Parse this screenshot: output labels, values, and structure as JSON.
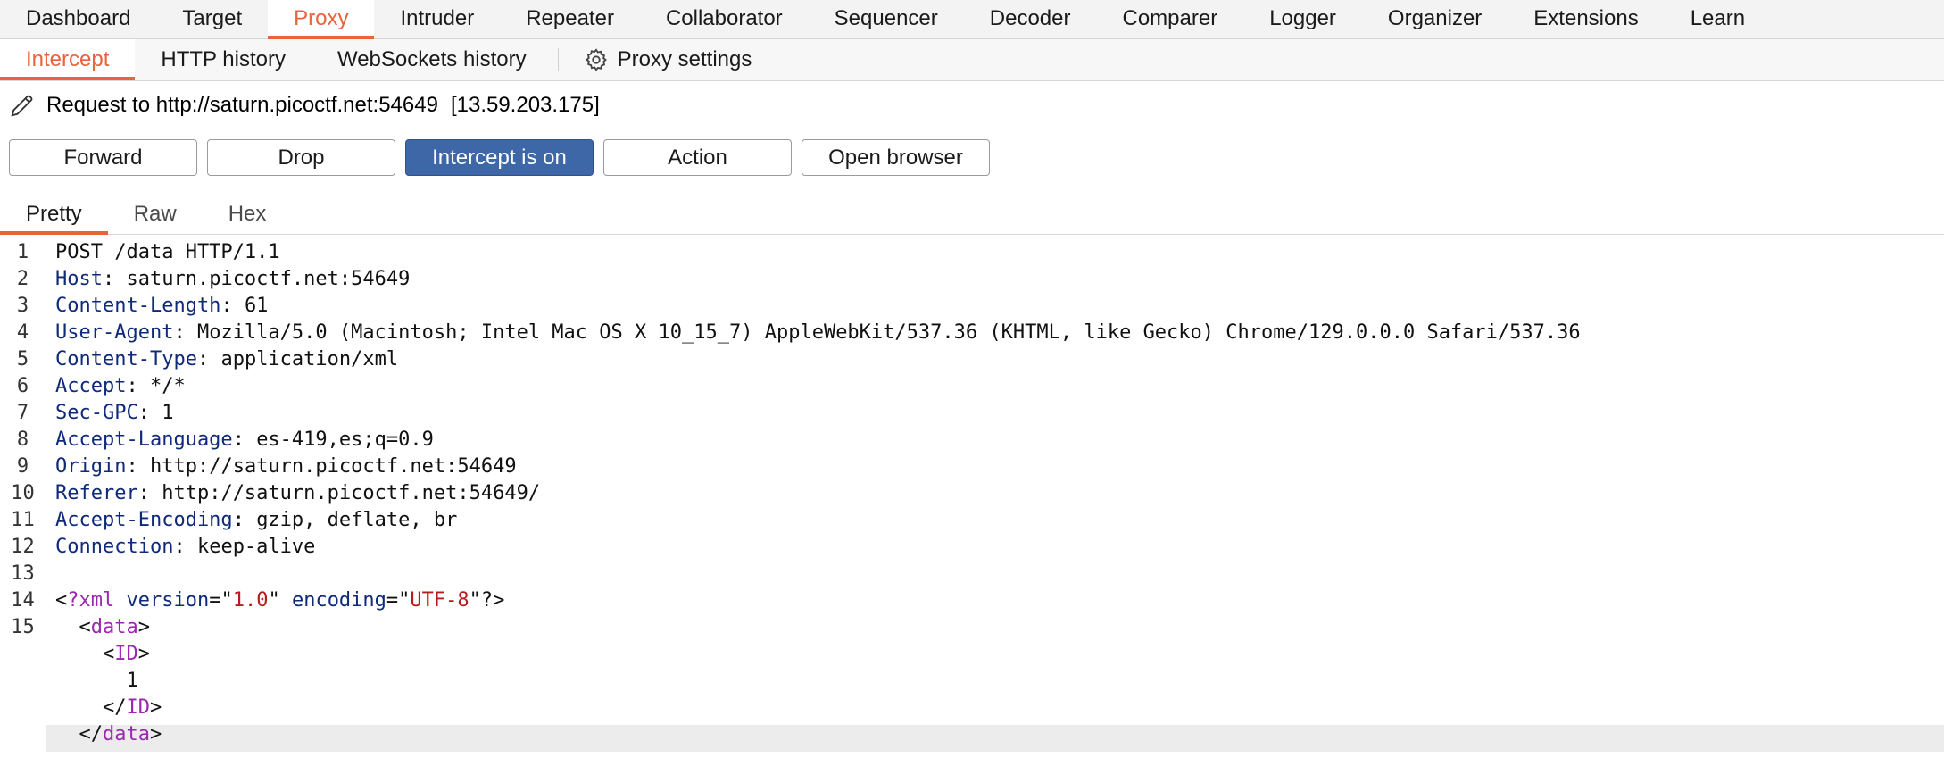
{
  "top_tabs": [
    "Dashboard",
    "Target",
    "Proxy",
    "Intruder",
    "Repeater",
    "Collaborator",
    "Sequencer",
    "Decoder",
    "Comparer",
    "Logger",
    "Organizer",
    "Extensions",
    "Learn"
  ],
  "top_active": "Proxy",
  "sub_tabs": [
    "Intercept",
    "HTTP history",
    "WebSockets history"
  ],
  "sub_active": "Intercept",
  "proxy_settings_label": "Proxy settings",
  "request": {
    "label": "Request to http://saturn.picoctf.net:54649",
    "ip": "[13.59.203.175]"
  },
  "buttons": {
    "forward": "Forward",
    "drop": "Drop",
    "intercept": "Intercept is on",
    "action": "Action",
    "open_browser": "Open browser"
  },
  "editor_tabs": [
    "Pretty",
    "Raw",
    "Hex"
  ],
  "editor_active": "Pretty",
  "line_numbers": [
    "1",
    "2",
    "3",
    "4",
    "5",
    "6",
    "7",
    "8",
    "9",
    "10",
    "11",
    "12",
    "13",
    "14",
    "15"
  ],
  "request_line": "POST /data HTTP/1.1",
  "headers": [
    {
      "key": "Host",
      "value": "saturn.picoctf.net:54649"
    },
    {
      "key": "Content-Length",
      "value": "61"
    },
    {
      "key": "User-Agent",
      "value": "Mozilla/5.0 (Macintosh; Intel Mac OS X 10_15_7) AppleWebKit/537.36 (KHTML, like Gecko) Chrome/129.0.0.0 Safari/537.36"
    },
    {
      "key": "Content-Type",
      "value": "application/xml"
    },
    {
      "key": "Accept",
      "value": "*/*"
    },
    {
      "key": "Sec-GPC",
      "value": "1"
    },
    {
      "key": "Accept-Language",
      "value": "es-419,es;q=0.9"
    },
    {
      "key": "Origin",
      "value": "http://saturn.picoctf.net:54649"
    },
    {
      "key": "Referer",
      "value": "http://saturn.picoctf.net:54649/"
    },
    {
      "key": "Accept-Encoding",
      "value": "gzip, deflate, br"
    },
    {
      "key": "Connection",
      "value": "keep-alive"
    }
  ],
  "xml": {
    "decl_tag": "?xml",
    "version_attr": "version",
    "version_value": "1.0",
    "encoding_attr": "encoding",
    "encoding_value": "UTF-8",
    "decl_end": "?>",
    "root_tag": "data",
    "child_tag": "ID",
    "child_value": "1"
  },
  "colors": {
    "accent": "#e8643c",
    "primary_button": "#3d67a6",
    "header_key": "#0f2a7a",
    "xml_tag": "#9c27b0",
    "xml_value": "#b71c1c"
  }
}
